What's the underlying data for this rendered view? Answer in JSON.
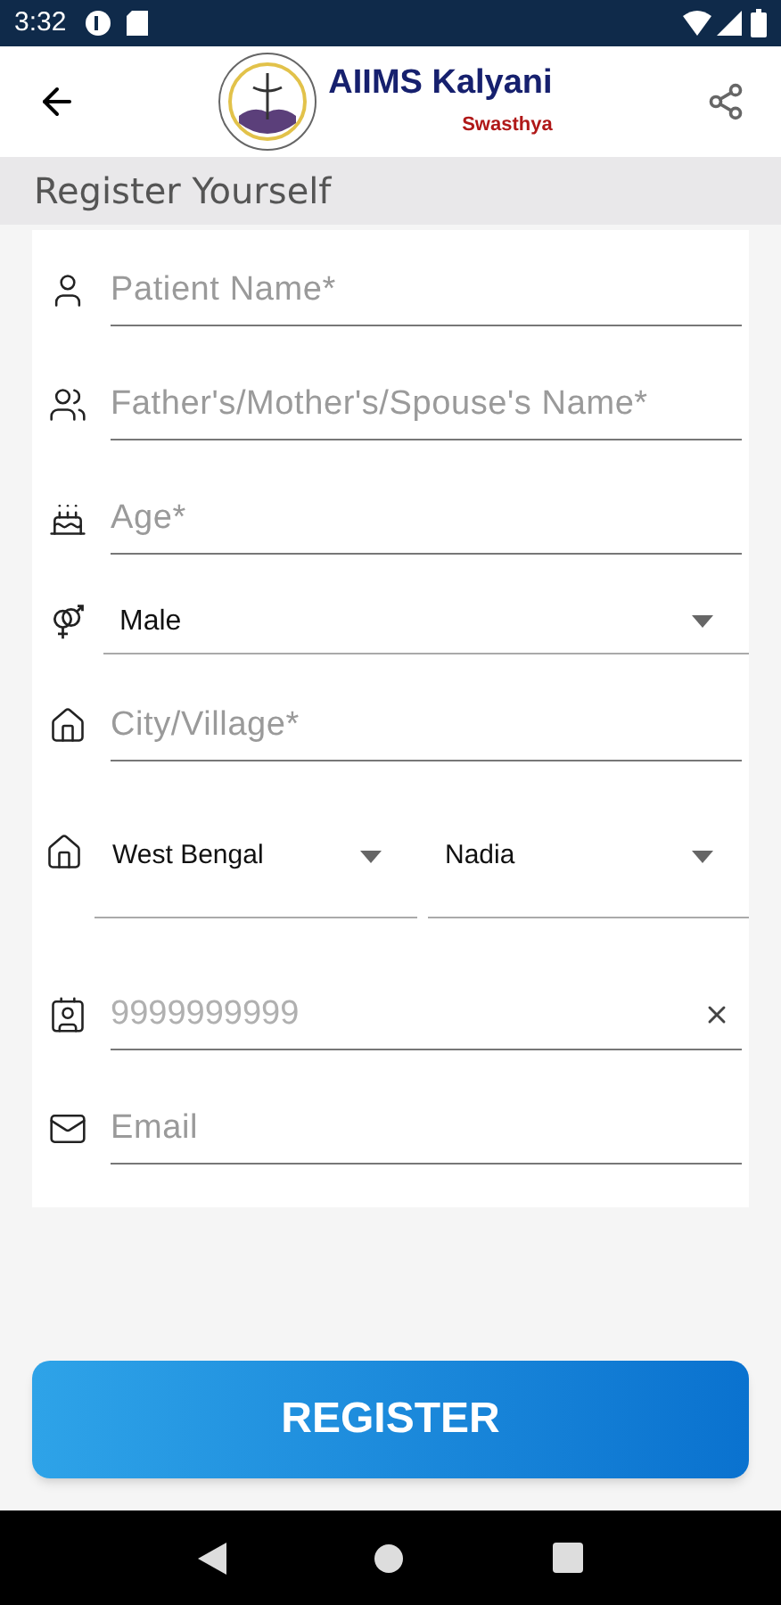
{
  "status_bar": {
    "time": "3:32"
  },
  "app_bar": {
    "title": "AIIMS Kalyani",
    "subtitle": "Swasthya"
  },
  "section": {
    "title": "Register Yourself"
  },
  "fields": [
    {
      "kind": "text",
      "placeholder": "Patient Name*"
    },
    {
      "kind": "text",
      "placeholder": "Father's/Mother's/Spouse's Name*"
    },
    {
      "kind": "text",
      "placeholder": "Age*"
    },
    {
      "kind": "dropdown",
      "value": "Male"
    },
    {
      "kind": "text",
      "placeholder": "City/Village*"
    },
    {
      "kind": "pair",
      "values": [
        "West Bengal",
        "Nadia"
      ]
    },
    {
      "kind": "clearable",
      "placeholder": "9999999999"
    },
    {
      "kind": "text",
      "placeholder": "Email"
    }
  ],
  "button": {
    "label": "REGISTER"
  }
}
